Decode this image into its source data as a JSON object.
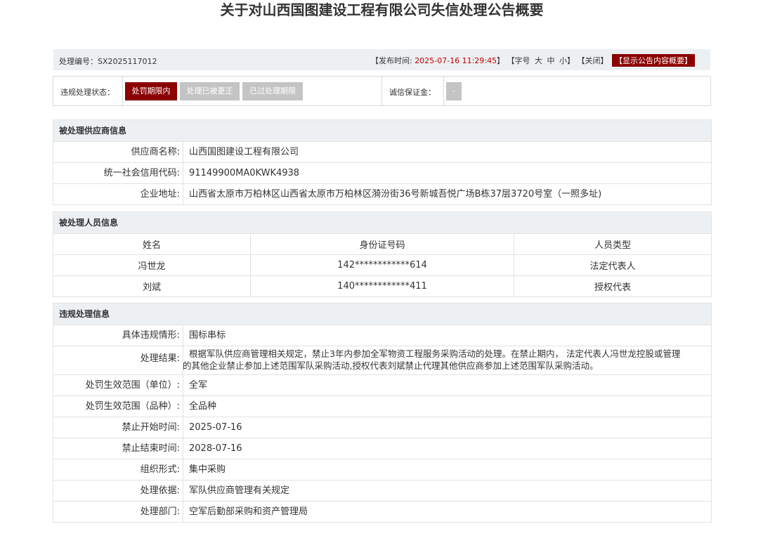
{
  "title": "关于对山西国图建设工程有限公司失信处理公告概要",
  "infobar": {
    "serial_label": "处理编号：",
    "serial_value": "SX2025117012",
    "publish_prefix": "【发布时间:",
    "publish_time": "2025-07-16 11:29:45",
    "publish_suffix": "】",
    "font_open": "【字号",
    "font_large": "大",
    "font_medium": "中",
    "font_small": "小",
    "font_close": "】",
    "close_link": "【关闭】",
    "summary_button": "【显示公告内容概要】"
  },
  "status": {
    "label": "违规处理状态：",
    "buttons": [
      "处罚期限内",
      "处理已被更正",
      "已过处理期限"
    ],
    "active_index": 0,
    "deposit_label": "诚信保证金：",
    "deposit_value": "-"
  },
  "supplier": {
    "header": "被处理供应商信息",
    "rows": [
      {
        "k": "供应商名称:",
        "v": "山西国图建设工程有限公司"
      },
      {
        "k": "统一社会信用代码:",
        "v": "91149900MA0KWK4938"
      },
      {
        "k": "企业地址:",
        "v": "山西省太原市万柏林区山西省太原市万柏林区漪汾街36号新城吾悦广场B栋37层3720号室（一照多址)"
      }
    ]
  },
  "persons": {
    "header": "被处理人员信息",
    "columns": [
      "姓名",
      "身份证号码",
      "人员类型"
    ],
    "rows": [
      [
        "冯世龙",
        "142************614",
        "法定代表人"
      ],
      [
        "刘斌",
        "140************411",
        "授权代表"
      ]
    ]
  },
  "violation": {
    "header": "违规处理信息",
    "rows": [
      {
        "k": "具体违规情形:",
        "v": "围标串标"
      },
      {
        "k": "处理结果:",
        "v_line1": "根据军队供应商管理相关规定，禁止3年内参加全军物资工程服务采购活动的处理。在禁止期内， 法定代表人冯世龙控股或管理",
        "v_line2": "的其他企业禁止参加上述范围军队采购活动,授权代表刘斌禁止代理其他供应商参加上述范围军队采购活动。"
      },
      {
        "k": "处罚生效范围（单位）:",
        "v": "全军"
      },
      {
        "k": "处罚生效范围（品种）:",
        "v": "全品种"
      },
      {
        "k": "禁止开始时间:",
        "v": "2025-07-16"
      },
      {
        "k": "禁止结束时间:",
        "v": "2028-07-16"
      },
      {
        "k": "组织形式:",
        "v": "集中采购"
      },
      {
        "k": "处理依据:",
        "v": "军队供应商管理有关规定"
      },
      {
        "k": "处理部门:",
        "v": "空军后勤部采购和资产管理局"
      }
    ]
  }
}
